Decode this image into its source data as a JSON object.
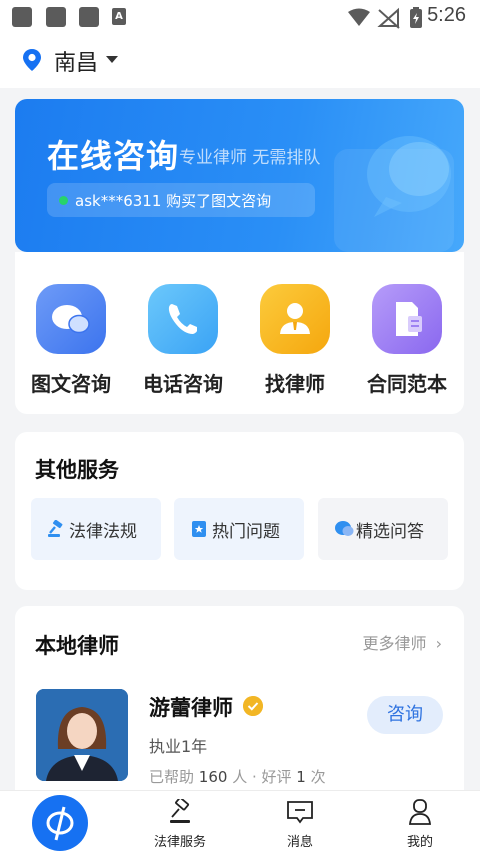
{
  "status_bar": {
    "time": "5:26",
    "badge": "A"
  },
  "location": {
    "city": "南昌"
  },
  "banner": {
    "title": "在线咨询",
    "subtitle": "专业律师 无需排队",
    "ticker": "ask***6311 购买了图文咨询"
  },
  "quick_actions": [
    {
      "label": "图文咨询",
      "icon": "chat-bubbles-icon"
    },
    {
      "label": "电话咨询",
      "icon": "phone-icon"
    },
    {
      "label": "找律师",
      "icon": "lawyer-icon"
    },
    {
      "label": "合同范本",
      "icon": "document-icon"
    }
  ],
  "other_services": {
    "title": "其他服务",
    "items": [
      {
        "label": "法律法规",
        "icon": "gavel-icon"
      },
      {
        "label": "热门问题",
        "icon": "star-bookmark-icon"
      },
      {
        "label": "精选问答",
        "icon": "qa-bubble-icon"
      }
    ]
  },
  "local_lawyers": {
    "title": "本地律师",
    "more": "更多律师",
    "lawyer": {
      "name": "游蕾律师",
      "years": "执业1年",
      "stats_prefix": "已帮助 ",
      "helped": "160",
      "stats_mid": " 人 · 好评 ",
      "good_reviews": "1",
      "stats_suffix": " 次",
      "consult": "咨询"
    }
  },
  "tab_bar": {
    "items": [
      {
        "label": "法律服务",
        "icon": "gavel-icon"
      },
      {
        "label": "消息",
        "icon": "message-icon"
      },
      {
        "label": "我的",
        "icon": "profile-icon"
      }
    ]
  },
  "colors": {
    "primary": "#1671f2",
    "banner": "#2a8ff6",
    "accent_gold": "#f2b625"
  }
}
